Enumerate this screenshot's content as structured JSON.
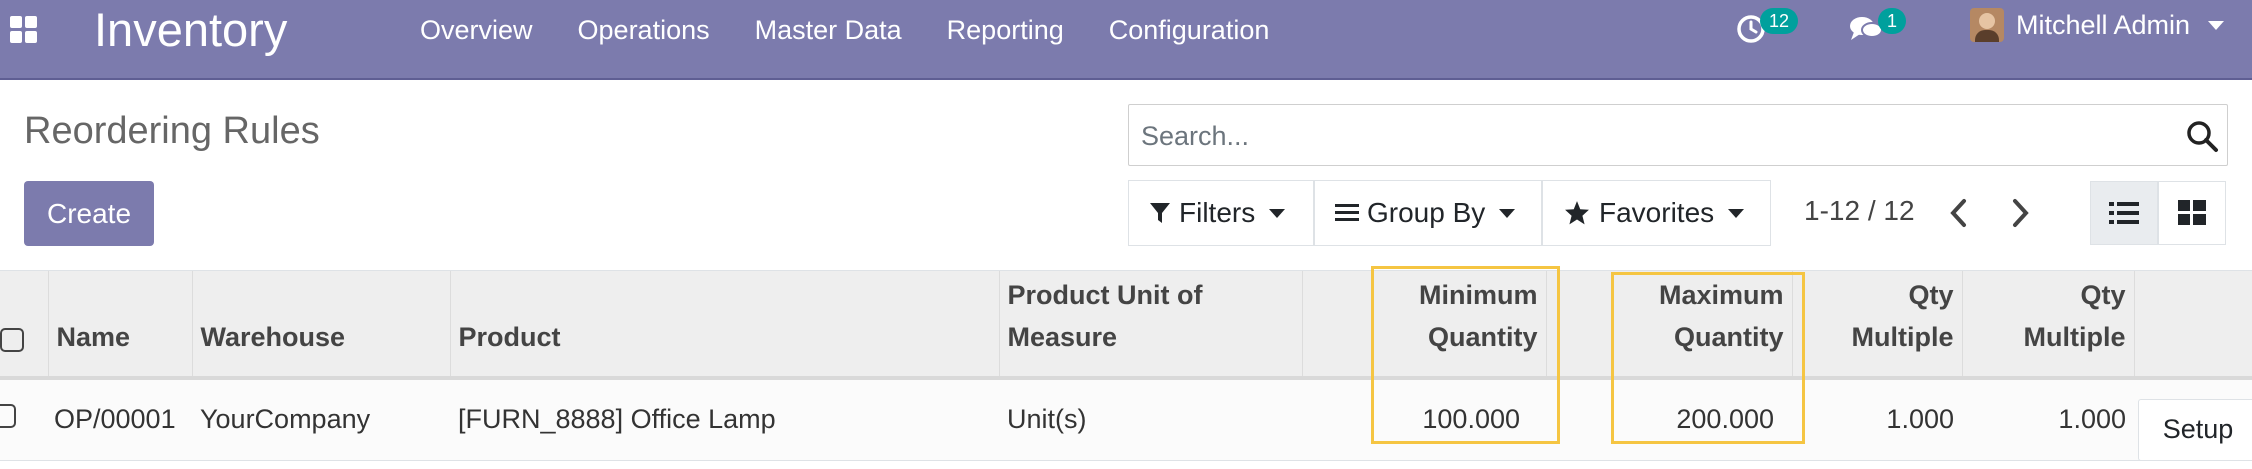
{
  "navbar": {
    "brand": "Inventory",
    "menu": [
      "Overview",
      "Operations",
      "Master Data",
      "Reporting",
      "Configuration"
    ],
    "activity_count": "12",
    "messages_count": "1",
    "user_name": "Mitchell Admin"
  },
  "control_panel": {
    "title": "Reordering Rules",
    "create_label": "Create",
    "search_placeholder": "Search...",
    "filters_label": "Filters",
    "groupby_label": "Group By",
    "favorites_label": "Favorites",
    "pager": "1-12 / 12"
  },
  "table": {
    "columns": [
      {
        "line1": "",
        "line2": "Name"
      },
      {
        "line1": "",
        "line2": "Warehouse"
      },
      {
        "line1": "",
        "line2": "Product"
      },
      {
        "line1": "Product Unit of",
        "line2": "Measure"
      },
      {
        "line1": "Minimum",
        "line2": "Quantity"
      },
      {
        "line1": "Maximum",
        "line2": "Quantity"
      },
      {
        "line1": "Qty",
        "line2": "Multiple"
      },
      {
        "line1": "Qty",
        "line2": "Multiple"
      }
    ],
    "rows": [
      {
        "name": "OP/00001",
        "warehouse": "YourCompany",
        "product": "[FURN_8888] Office Lamp",
        "uom": "Unit(s)",
        "min_qty": "100.000",
        "max_qty": "200.000",
        "qty_multiple_1": "1.000",
        "qty_multiple_2": "1.000",
        "action_label": "Setup"
      }
    ]
  },
  "colors": {
    "navbar": "#7c7bad",
    "badge": "#00a09d",
    "highlight": "#f5c542"
  }
}
